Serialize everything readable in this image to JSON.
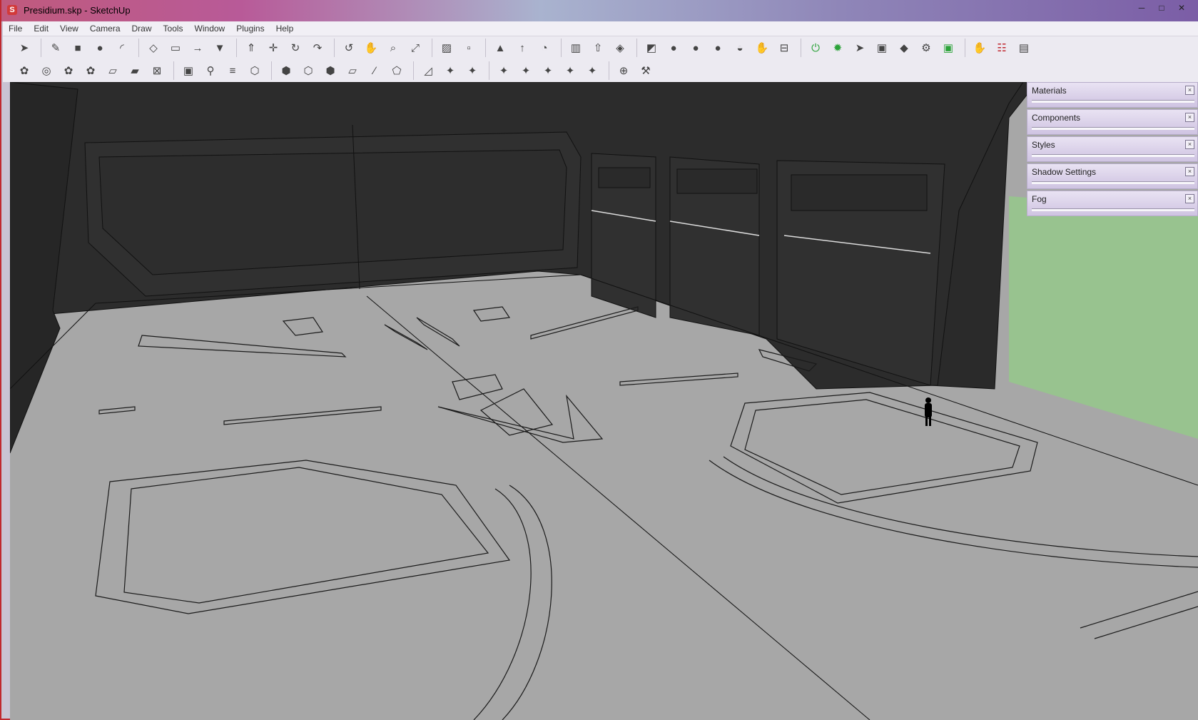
{
  "window": {
    "title": "Presidium.skp - SketchUp",
    "app_icon": "sketchup-icon",
    "controls": {
      "minimize": "─",
      "maximize": "□",
      "close": "✕"
    }
  },
  "menu": [
    "File",
    "Edit",
    "View",
    "Camera",
    "Draw",
    "Tools",
    "Window",
    "Plugins",
    "Help"
  ],
  "toolbar_row1": [
    "select-icon",
    "sep",
    "pencil-icon",
    "rectangle-icon",
    "circle-icon",
    "arc-icon",
    "sep",
    "make-component-icon",
    "eraser-icon",
    "tape-measure-icon",
    "paint-bucket-icon",
    "sep",
    "push-pull-icon",
    "move-icon",
    "rotate-icon",
    "follow-me-icon",
    "sep",
    "orbit-icon",
    "pan-icon",
    "zoom-icon",
    "zoom-extents-icon",
    "sep",
    "section-plane-icon",
    "previous-view-icon",
    "sep",
    "add-location-icon",
    "toggle-terrain-icon",
    "photo-textures-icon",
    "sep",
    "get-models-icon",
    "share-model-icon",
    "share-component-icon",
    "sep",
    "sandbox-icon",
    "smoove-icon",
    "stamp-icon",
    "drape-icon",
    "add-detail-icon",
    "hand-icon",
    "lock-icon",
    "sep",
    "power-icon",
    "sun-icon",
    "cursor-icon",
    "tray-icon",
    "render-icon",
    "settings-icon",
    "display-icon",
    "sep",
    "wave-icon",
    "report-icon",
    "trash-icon"
  ],
  "toolbar_row2": [
    "component-icon",
    "orbit-camera-icon",
    "walk-icon",
    "look-around-icon",
    "position-camera-icon",
    "plane-icon",
    "xray-icon",
    "sep",
    "layer-icon",
    "search-pin-icon",
    "level-icon",
    "outer-shell-icon",
    "sep",
    "intersect-icon",
    "union-icon",
    "subtract-icon",
    "trim-icon",
    "split-icon",
    "box-icon",
    "sep",
    "front-view-icon",
    "back-view-icon",
    "left-view-icon",
    "sep",
    "top-view-icon",
    "right-view-icon",
    "iso-view-icon",
    "parallel-icon",
    "perspective-icon",
    "sep",
    "crosshair-icon",
    "tools-icon"
  ],
  "icon_glyphs": {
    "select-icon": "➤",
    "pencil-icon": "✎",
    "rectangle-icon": "■",
    "circle-icon": "●",
    "arc-icon": "◜",
    "make-component-icon": "◇",
    "eraser-icon": "▭",
    "tape-measure-icon": "→",
    "paint-bucket-icon": "▼",
    "push-pull-icon": "⇑",
    "move-icon": "✛",
    "rotate-icon": "↻",
    "follow-me-icon": "↷",
    "orbit-icon": "↺",
    "pan-icon": "✋",
    "zoom-icon": "⌕",
    "zoom-extents-icon": "⤢",
    "section-plane-icon": "▨",
    "previous-view-icon": "▫",
    "add-location-icon": "▲",
    "toggle-terrain-icon": "↑",
    "photo-textures-icon": "◔",
    "get-models-icon": "▥",
    "share-model-icon": "⇧",
    "share-component-icon": "◈",
    "sandbox-icon": "◩",
    "smoove-icon": "●",
    "stamp-icon": "●",
    "drape-icon": "●",
    "add-detail-icon": "◒",
    "hand-icon": "✋",
    "lock-icon": "⊟",
    "power-icon": "⏻",
    "sun-icon": "✹",
    "cursor-icon": "➤",
    "tray-icon": "▣",
    "render-icon": "◆",
    "settings-icon": "⚙",
    "display-icon": "▣",
    "wave-icon": "✋",
    "report-icon": "☷",
    "trash-icon": "▤",
    "component-icon": "✿",
    "orbit-camera-icon": "◎",
    "walk-icon": "✿",
    "look-around-icon": "✿",
    "position-camera-icon": "▱",
    "plane-icon": "▰",
    "xray-icon": "⊠",
    "layer-icon": "▣",
    "search-pin-icon": "⚲",
    "level-icon": "≡",
    "outer-shell-icon": "⬡",
    "intersect-icon": "⬢",
    "union-icon": "⬡",
    "subtract-icon": "⬢",
    "trim-icon": "▱",
    "split-icon": "∕",
    "box-icon": "⬠",
    "front-view-icon": "◿",
    "back-view-icon": "✦",
    "left-view-icon": "✦",
    "top-view-icon": "✦",
    "right-view-icon": "✦",
    "iso-view-icon": "✦",
    "parallel-icon": "✦",
    "perspective-icon": "✦",
    "crosshair-icon": "⊕",
    "tools-icon": "⚒"
  },
  "highlight_colors": {
    "power-icon": "#2ca33a",
    "sun-icon": "#2ca33a",
    "display-icon": "#2ca33a",
    "report-icon": "#c0282f"
  },
  "tray_panels": [
    {
      "label": "Materials",
      "name": "materials"
    },
    {
      "label": "Components",
      "name": "components"
    },
    {
      "label": "Styles",
      "name": "styles"
    },
    {
      "label": "Shadow Settings",
      "name": "shadow-settings"
    },
    {
      "label": "Fog",
      "name": "fog"
    }
  ],
  "colors": {
    "wall": "#2c2c2c",
    "floor": "#a7a7a7",
    "sky_green": "#98c38f",
    "edge": "#111111",
    "frame_red": "#c0282f"
  }
}
